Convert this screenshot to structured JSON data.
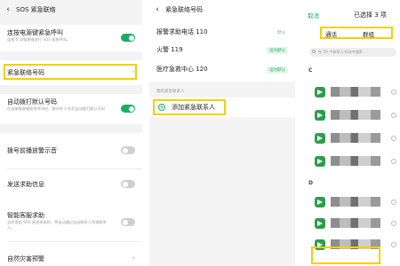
{
  "panel1": {
    "title": "SOS 紧急联络",
    "items": [
      {
        "label": "连按电源键紧急呼叫",
        "desc": "连按 5 次电源键进行 SOS 紧急呼叫。"
      },
      {
        "label": "紧急联络号码"
      },
      {
        "label": "自动拨打默认号码",
        "desc": "在连按电源键紧急呼叫时，倒计时 3 秒后自动拨打默认号码"
      },
      {
        "label": "拨号前播放警示音"
      },
      {
        "label": "发送求助信息"
      },
      {
        "label": "智能客服求助",
        "desc": "当你发起 SOS 紧急求助时，将自动通过自动联系人列表联系人。"
      },
      {
        "label": "自然灾害预警"
      }
    ]
  },
  "panel2": {
    "title": "紧急联络号码",
    "numbers": [
      {
        "label": "报警求助电话 110",
        "badge": "默认"
      },
      {
        "label": "火警 119",
        "badge": "设为默认"
      },
      {
        "label": "医疗急救中心 120",
        "badge": "设为默认"
      }
    ],
    "section_label": "我的紧急联系人",
    "add_contact": "添加紧急联系人"
  },
  "panel3": {
    "cancel": "取消",
    "selected": "已选择 3 项",
    "tabs": [
      "通话",
      "群组"
    ],
    "search_placeholder": "在 59 个联系人号码中搜索",
    "letters": [
      "C",
      "D"
    ]
  },
  "colors": {
    "accent": "#1aad5f",
    "highlight": "#f3d000"
  }
}
